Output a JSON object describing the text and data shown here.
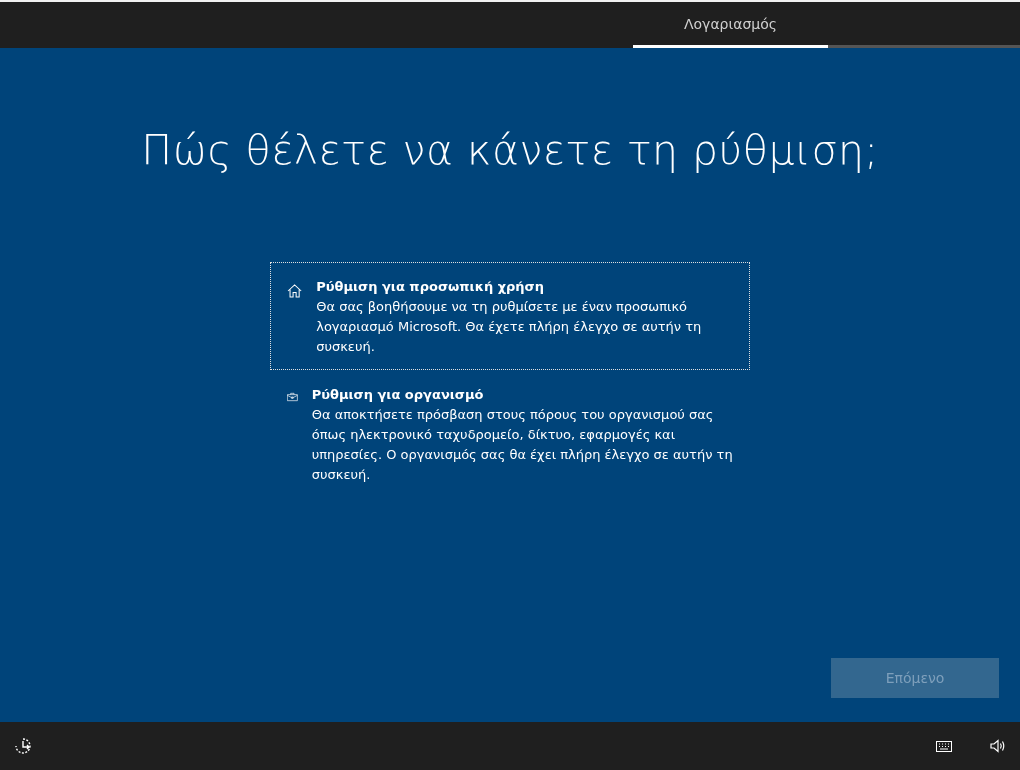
{
  "tabs": [
    {
      "label": "Λογαριασμός",
      "selected": true
    }
  ],
  "title": "Πώς θέλετε να κάνετε τη ρύθμιση;",
  "options": [
    {
      "kind": "home",
      "title": "Ρύθμιση για προσωπική χρήση",
      "description": "Θα σας βοηθήσουμε να τη ρυθμίσετε με έναν προσωπικό λογαριασμό Microsoft. Θα έχετε πλήρη έλεγχο σε αυτήν τη συσκευή.",
      "selected": true
    },
    {
      "kind": "work",
      "title": "Ρύθμιση για οργανισμό",
      "description": "Θα αποκτήσετε πρόσβαση στους πόρους του οργανισμού σας όπως ηλεκτρονικό ταχυδρομείο, δίκτυο, εφαρμογές και υπηρεσίες. Ο οργανισμός σας θα έχει πλήρη έλεγχο σε αυτήν τη συσκευή.",
      "selected": false
    }
  ],
  "next_button": {
    "label": "Επόμενο",
    "disabled": true
  }
}
